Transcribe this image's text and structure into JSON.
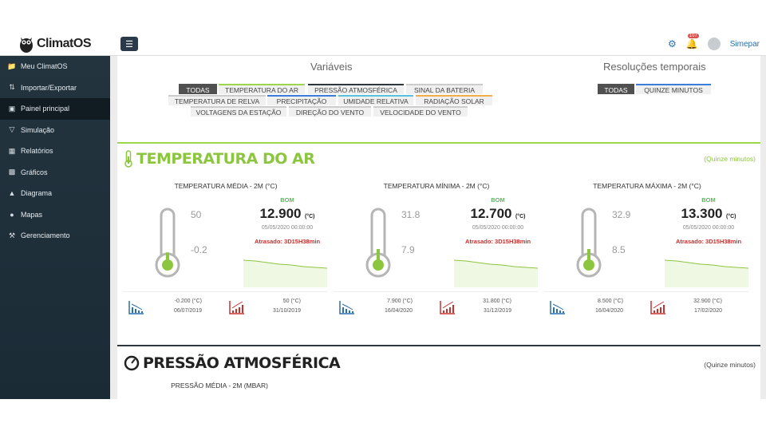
{
  "header": {
    "brand": "ClimatOS",
    "notification_count": "107",
    "user": "Simepar"
  },
  "sidebar": {
    "items": [
      {
        "label": "Meu ClimatOS",
        "icon": "folder-icon"
      },
      {
        "label": "Importar/Exportar",
        "icon": "transfer-icon"
      },
      {
        "label": "Painel principal",
        "icon": "monitor-icon"
      },
      {
        "label": "Simulação",
        "icon": "filter-icon"
      },
      {
        "label": "Relatórios",
        "icon": "table-icon"
      },
      {
        "label": "Gráficos",
        "icon": "bar-chart-icon"
      },
      {
        "label": "Diagrama",
        "icon": "sitemap-icon"
      },
      {
        "label": "Mapas",
        "icon": "globe-icon"
      },
      {
        "label": "Gerenciamento",
        "icon": "wrench-icon"
      }
    ]
  },
  "variables": {
    "title": "Variáveis",
    "chips": [
      {
        "label": "TODAS",
        "color": "#505050"
      },
      {
        "label": "TEMPERATURA DO AR",
        "color": "#9bd64d"
      },
      {
        "label": "PRESSÃO ATMOSFÉRICA",
        "color": "#2d3740"
      },
      {
        "label": "SINAL DA BATERIA",
        "color": "#cccccc"
      },
      {
        "label": "TEMPERATURA DE RELVA",
        "color": "#cccccc"
      },
      {
        "label": "PRECIPITAÇÃO",
        "color": "#3b7dd8"
      },
      {
        "label": "UMIDADE RELATIVA",
        "color": "#5bc0de"
      },
      {
        "label": "RADIAÇÃO SOLAR",
        "color": "#f0ad4e"
      },
      {
        "label": "VOLTAGENS DA ESTAÇÃO",
        "color": "#cccccc"
      },
      {
        "label": "DIREÇÃO DO VENTO",
        "color": "#cccccc"
      },
      {
        "label": "VELOCIDADE DO VENTO",
        "color": "#cccccc"
      }
    ]
  },
  "resolutions": {
    "title": "Resoluções temporais",
    "chips": [
      {
        "label": "TODAS",
        "color": "#505050"
      },
      {
        "label": "QUINZE MINUTOS",
        "color": "#3b7dd8"
      }
    ]
  },
  "temperature": {
    "title": "TEMPERATURA DO AR",
    "resolution": "(Quinze minutos)",
    "cards": [
      {
        "title": "TEMPERATURA MÉDIA - 2M (°C)",
        "max_label": "50",
        "min_label": "-0.2",
        "status": "BOM",
        "value": "12.900",
        "unit": "(°C)",
        "date": "05/05/2020 00:00:00",
        "delay": "Atrasado: 3D15H38min",
        "fill": 0.13,
        "min_value": "-0.200",
        "min_unit": "(°C)",
        "min_date": "06/07/2019",
        "max_value": "50",
        "max_unit": "(°C)",
        "max_date": "31/10/2019"
      },
      {
        "title": "TEMPERATURA MÍNIMA - 2M (°C)",
        "max_label": "31.8",
        "min_label": "7.9",
        "status": "BOM",
        "value": "12.700",
        "unit": "(°C)",
        "date": "05/05/2020 00:00:00",
        "delay": "Atrasado: 3D15H38min",
        "fill": 0.2,
        "min_value": "7.900",
        "min_unit": "(°C)",
        "min_date": "16/04/2020",
        "max_value": "31.800",
        "max_unit": "(°C)",
        "max_date": "31/12/2019"
      },
      {
        "title": "TEMPERATURA MÁXIMA - 2M (°C)",
        "max_label": "32.9",
        "min_label": "8.5",
        "status": "BOM",
        "value": "13.300",
        "unit": "(°C)",
        "date": "05/05/2020 00:00:00",
        "delay": "Atrasado: 3D15H38min",
        "fill": 0.2,
        "min_value": "8.500",
        "min_unit": "(°C)",
        "min_date": "16/04/2020",
        "max_value": "32.900",
        "max_unit": "(°C)",
        "max_date": "17/02/2020"
      }
    ]
  },
  "pressure": {
    "title": "PRESSÃO ATMOSFÉRICA",
    "resolution": "(Quinze minutos)",
    "card_title": "PRESSÃO MÉDIA - 2M (MBAR)"
  }
}
